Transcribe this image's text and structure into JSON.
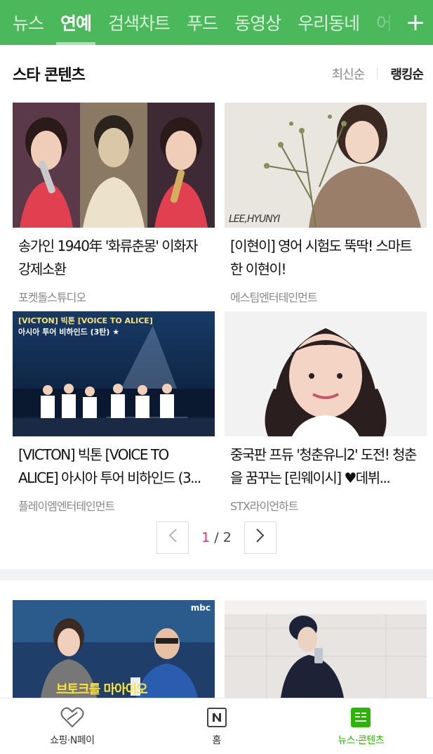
{
  "nav": {
    "tabs": [
      "뉴스",
      "연예",
      "검색차트",
      "푸드",
      "동영상",
      "우리동네",
      "어"
    ],
    "active_index": 1,
    "plus_label": "+"
  },
  "section": {
    "title": "스타 콘텐츠",
    "sort_latest": "최신순",
    "sort_ranking": "랭킹순",
    "active_sort": "랭킹순"
  },
  "cards": [
    {
      "title": "송가인 1940年 '화류춘몽' 이화자 강제소환",
      "source": "포켓돌스튜디오"
    },
    {
      "title": "[이현이] 영어 시험도 뚝딱! 스마트한 이현이!",
      "source": "에스팀엔터테인먼트",
      "thumb_caption": "LEE,HYUNYI"
    },
    {
      "title": "[VICTON] 빅톤 [VOICE TO ALICE] 아시아 투어 비하인드 (3...",
      "source": "플레이엠엔터테인먼트",
      "thumb_caption_1": "[VICTON] 빅톤 [VOICE TO ALICE]",
      "thumb_caption_2": "아시아 투어 비하인드 (3탄) ★"
    },
    {
      "title": "중국판 프듀 '청춘유니2' 도전! 청춘을 꿈꾸는 [린웨이시] ♥데뷔...",
      "source": "STX라이언하트"
    }
  ],
  "pager": {
    "current": "1",
    "total": "/ 2",
    "prev_icon": "chevron-left-icon",
    "next_icon": "chevron-right-icon"
  },
  "next_cards": [
    {
      "thumb_caption": "브토크를 마아이오",
      "badge": "mbc"
    },
    {
      "thumb_caption": ""
    }
  ],
  "bottom_bar": [
    {
      "label": "쇼핑·N페이",
      "icon": "heart-tag-icon"
    },
    {
      "label": "홈",
      "icon": "naver-n-icon"
    },
    {
      "label": "뉴스·콘텐츠",
      "icon": "news-icon"
    }
  ],
  "colors": {
    "brand_green": "#4cb85c",
    "active_green": "#2db400",
    "page_current": "#e0306b"
  }
}
